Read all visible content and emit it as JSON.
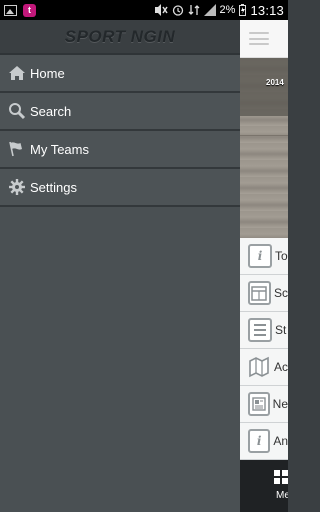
{
  "status_bar": {
    "battery": "2%",
    "time": "13:13"
  },
  "drawer": {
    "logo_text": "SPORT NGIN",
    "items": [
      {
        "label": "Home",
        "icon": "home-icon"
      },
      {
        "label": "Search",
        "icon": "search-icon"
      },
      {
        "label": "My Teams",
        "icon": "flags-icon"
      },
      {
        "label": "Settings",
        "icon": "gear-icon"
      }
    ]
  },
  "content": {
    "hero_year": "2014",
    "list": [
      {
        "label": "To",
        "icon": "info-icon"
      },
      {
        "label": "Sc",
        "icon": "schedule-icon"
      },
      {
        "label": "St",
        "icon": "standings-icon"
      },
      {
        "label": "Ac",
        "icon": "map-icon"
      },
      {
        "label": "Ne",
        "icon": "news-icon"
      },
      {
        "label": "An",
        "icon": "announcement-icon"
      }
    ],
    "bottom_nav_label": "Me"
  }
}
